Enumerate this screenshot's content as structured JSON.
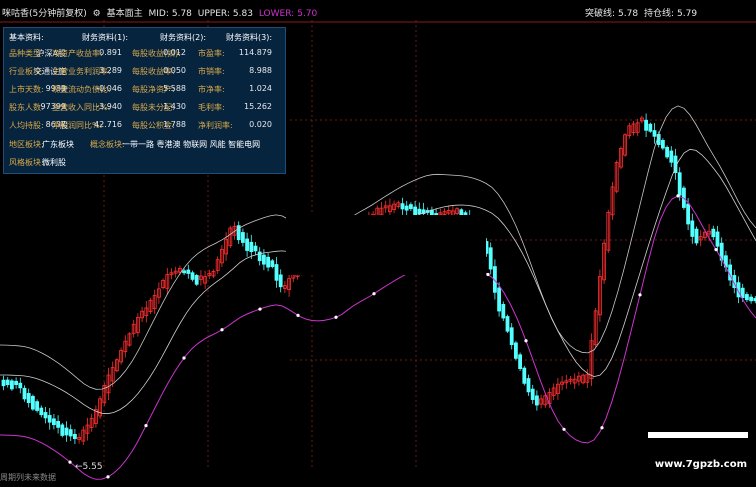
{
  "header": {
    "title": "咪咕香(5分钟前复权)",
    "indicator": "基本面主",
    "mid_label": "MID:",
    "mid_value": "5.78",
    "upper_label": "UPPER:",
    "upper_value": "5.83",
    "lower_label": "LOWER:",
    "lower_value": "5.70",
    "breakout_label": "突破线:",
    "breakout_value": "5.78",
    "position_label": "持仓线:",
    "position_value": "5.79"
  },
  "panel": {
    "columns": [
      "基本资料:",
      "财务资料(1):",
      "财务资料(2):",
      "财务资料(3):"
    ],
    "rows": [
      [
        {
          "l": "品种类型:",
          "v": "沪深A股"
        },
        {
          "l": "净资产收益率:",
          "v": "0.891"
        },
        {
          "l": "每股收益(扣):",
          "v": "0.012"
        },
        {
          "l": "市盈率:",
          "v": "114.879"
        }
      ],
      [
        {
          "l": "行业板块:",
          "v": "交通设施"
        },
        {
          "l": "主营业务利润率:",
          "v": "3.289"
        },
        {
          "l": "每股收益率:",
          "v": "0.050"
        },
        {
          "l": "市销率:",
          "v": "8.988"
        }
      ],
      [
        {
          "l": "上市天数:",
          "v": "9983",
          "u": "天"
        },
        {
          "l": "现金流动负债比:",
          "v": "-0.046"
        },
        {
          "l": "每股净资产:",
          "v": "5.588"
        },
        {
          "l": "市净率:",
          "v": "1.024"
        }
      ],
      [
        {
          "l": "股东人数:",
          "v": "97399",
          "u": "人"
        },
        {
          "l": "主营收入同比%:",
          "v": "-3.940"
        },
        {
          "l": "每股未分配:",
          "v": "1.430"
        },
        {
          "l": "毛利率:",
          "v": "15.262"
        }
      ],
      [
        {
          "l": "人均持股:",
          "v": "8637",
          "u": "股"
        },
        {
          "l": "净利润同比%:",
          "v": "42.716"
        },
        {
          "l": "每股公积金:",
          "v": "1.788"
        },
        {
          "l": "净利润率:",
          "v": "0.020"
        }
      ]
    ],
    "region_label": "地区板块:",
    "region_value": "广东板块",
    "concept_label": "概念板块:",
    "concept_value": "一带一路 粤港澳 物联网 风能 智能电网",
    "style_label": "风格板块:",
    "style_value": "微利股"
  },
  "low_price": "5.55",
  "future_label": "周期列未来数据",
  "watermark": "www.7gpzb.com",
  "colors": {
    "up": "#ff3030",
    "down": "#54ffff",
    "upper": "#c8c8c8",
    "mid": "#d0d0d0",
    "lower": "#cc33cc",
    "panel": "#07243f",
    "label": "#d9a94a"
  },
  "chart_data": {
    "type": "candlestick",
    "ylim": [
      5.45,
      5.95
    ],
    "y_unit": "price",
    "lines": [
      "MID",
      "UPPER",
      "LOWER",
      "突破线",
      "持仓线"
    ]
  }
}
